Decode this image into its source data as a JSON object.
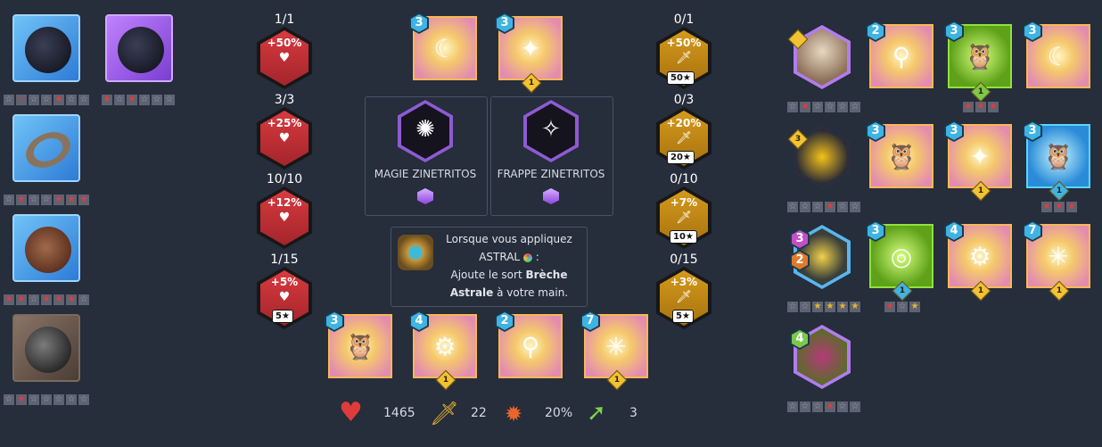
{
  "equipment": [
    {
      "name": "gem-relic",
      "stars": [
        "☆",
        "☆",
        "☆",
        "☆",
        "★",
        "☆",
        "☆"
      ]
    },
    {
      "name": "amulet",
      "stars": [
        "★",
        "☆",
        "★",
        "☆",
        "☆",
        "☆"
      ]
    },
    {
      "name": "ring",
      "stars": [
        "☆",
        "★",
        "☆",
        "☆",
        "★",
        "★",
        "★"
      ]
    },
    {
      "name": "gauntlet",
      "stars": [
        "★",
        "★",
        "☆",
        "★",
        "★",
        "★",
        "☆"
      ]
    },
    {
      "name": "pauldron",
      "stars": [
        "☆",
        "★",
        "☆",
        "☆",
        "☆",
        "☆",
        "☆"
      ]
    }
  ],
  "vitality": [
    {
      "fraction": "1/1",
      "value": "+50%"
    },
    {
      "fraction": "3/3",
      "value": "+25%"
    },
    {
      "fraction": "10/10",
      "value": "+12%"
    },
    {
      "fraction": "1/15",
      "value": "+5%",
      "badge": "5★"
    }
  ],
  "power": [
    {
      "fraction": "0/1",
      "value": "+50%",
      "badge": "50★"
    },
    {
      "fraction": "0/3",
      "value": "+20%",
      "badge": "20★"
    },
    {
      "fraction": "0/10",
      "value": "+7%",
      "badge": "10★"
    },
    {
      "fraction": "0/15",
      "value": "+3%",
      "badge": "5★"
    }
  ],
  "top_spells": [
    {
      "cost": "3"
    },
    {
      "cost": "3",
      "diamond": "1"
    }
  ],
  "bottom_spells": [
    {
      "cost": "3"
    },
    {
      "cost": "4",
      "diamond": "1"
    },
    {
      "cost": "2"
    },
    {
      "cost": "7",
      "diamond": "1"
    }
  ],
  "major_spells": [
    {
      "label": "MAGIE ZINETRITOS"
    },
    {
      "label": "FRAPPE ZINETRITOS"
    }
  ],
  "effect": {
    "line1": "Lorsque vous appliquez",
    "line2": "ASTRAL",
    "line2b": " :",
    "line3": "Ajoute le sort ",
    "line3b": "Brèche",
    "line4b": "Astrale",
    "line4": " à votre main."
  },
  "stats": {
    "health": "1465",
    "attack": "22",
    "crit": "20%",
    "movement": "3"
  },
  "companions": [
    {
      "cost": "",
      "stars": [
        "☆",
        "★",
        "☆",
        "☆",
        "☆",
        "☆"
      ]
    },
    {
      "cost": "3",
      "stars": [
        "☆",
        "☆",
        "☆",
        "★",
        "☆",
        "☆"
      ]
    },
    {
      "cost": "3",
      "cost2": "2",
      "stars": [
        "☆",
        "☆",
        "★",
        "★",
        "★",
        "★"
      ]
    },
    {
      "cost": "4",
      "stars": [
        "☆",
        "☆",
        "☆",
        "★",
        "☆",
        "☆"
      ]
    }
  ],
  "right_spells": [
    {
      "cost": "2"
    },
    {
      "cost": "3",
      "diamond": "1",
      "stars": [
        "★",
        "★",
        "★"
      ]
    },
    {
      "cost": "3"
    },
    {
      "cost": "3"
    },
    {
      "cost": "3",
      "diamond": "1"
    },
    {
      "cost": "3",
      "diamond": "1",
      "stars": [
        "★",
        "★",
        "★"
      ]
    },
    {
      "cost": "3",
      "diamond": "1",
      "stars": [
        "★",
        "☆",
        "★"
      ]
    },
    {
      "cost": "4",
      "diamond": "1"
    },
    {
      "cost": "7",
      "diamond": "1"
    }
  ]
}
